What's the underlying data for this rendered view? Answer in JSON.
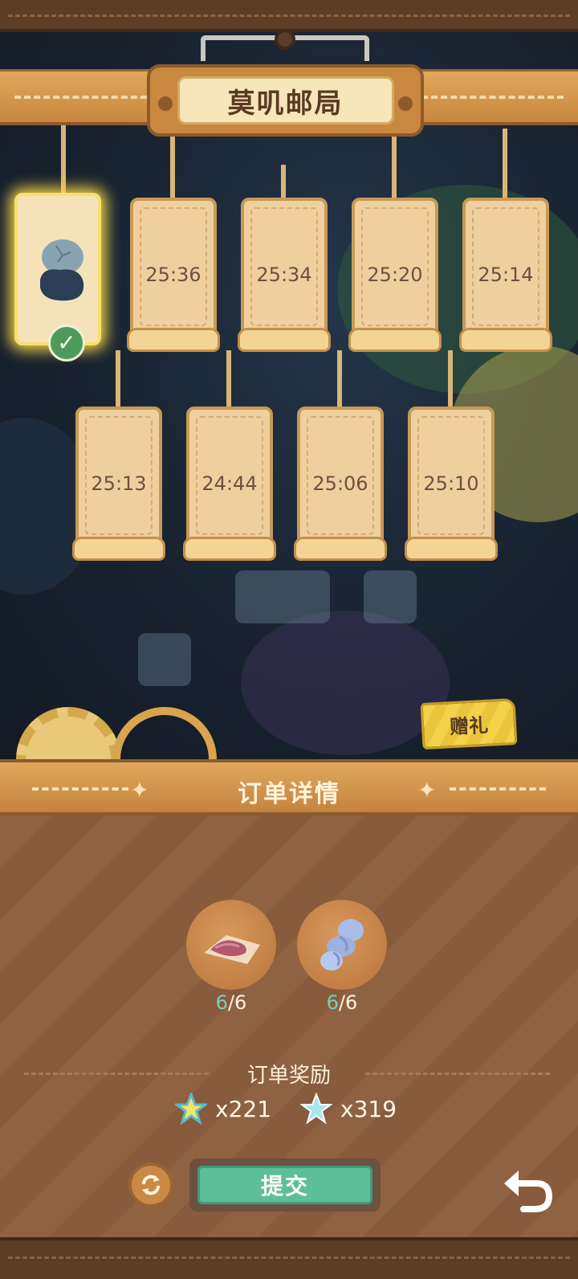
{
  "header": {
    "title": "莫叽邮局"
  },
  "letters": {
    "row1": [
      {
        "time": "25:36"
      },
      {
        "time": "25:34"
      },
      {
        "time": "25:20"
      },
      {
        "time": "25:14"
      }
    ],
    "row2": [
      {
        "time": "25:13"
      },
      {
        "time": "24:44"
      },
      {
        "time": "25:06"
      },
      {
        "time": "25:10"
      }
    ]
  },
  "gift": {
    "label": "赠礼"
  },
  "order": {
    "title": "订单详情",
    "items": [
      {
        "icon": "fabric-icon",
        "have": "6",
        "sep": "/",
        "need": "6"
      },
      {
        "icon": "yarn-icon",
        "have": "6",
        "sep": "/",
        "need": "6"
      }
    ],
    "reward_title": "订单奖励",
    "rewards": [
      {
        "icon": "sparkle-star-icon",
        "amount": "x221"
      },
      {
        "icon": "blue-star-icon",
        "amount": "x319"
      }
    ],
    "submit_label": "提交"
  },
  "colors": {
    "accent_green": "#5cbf9a",
    "highlight_count": "#7ad0b4",
    "wood": "#c58340"
  }
}
